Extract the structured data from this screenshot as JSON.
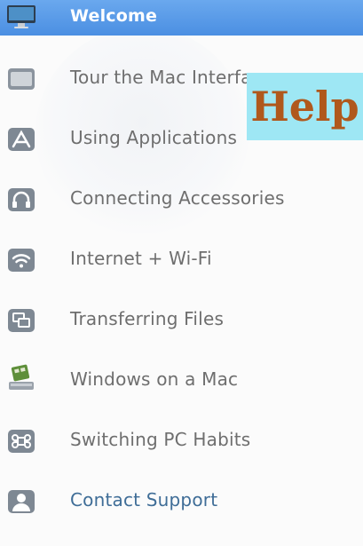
{
  "sidebar": {
    "items": [
      {
        "label": "Welcome",
        "icon": "display-icon"
      },
      {
        "label": "Tour the Mac Interface",
        "icon": "window-icon"
      },
      {
        "label": "Using Applications",
        "icon": "app-store-icon"
      },
      {
        "label": "Connecting Accessories",
        "icon": "headphones-icon"
      },
      {
        "label": "Internet + Wi-Fi",
        "icon": "wifi-icon"
      },
      {
        "label": "Transferring Files",
        "icon": "transfer-icon"
      },
      {
        "label": "Windows on a Mac",
        "icon": "windows-drive-icon"
      },
      {
        "label": "Switching PC Habits",
        "icon": "command-key-icon"
      },
      {
        "label": "Contact Support",
        "icon": "person-icon"
      }
    ]
  },
  "overlay": {
    "help_label": "Help"
  },
  "colors": {
    "selection": "#4b8fe2",
    "link": "#3f6d97",
    "help_bg": "#9ee7f4",
    "help_text": "#b0581c"
  }
}
